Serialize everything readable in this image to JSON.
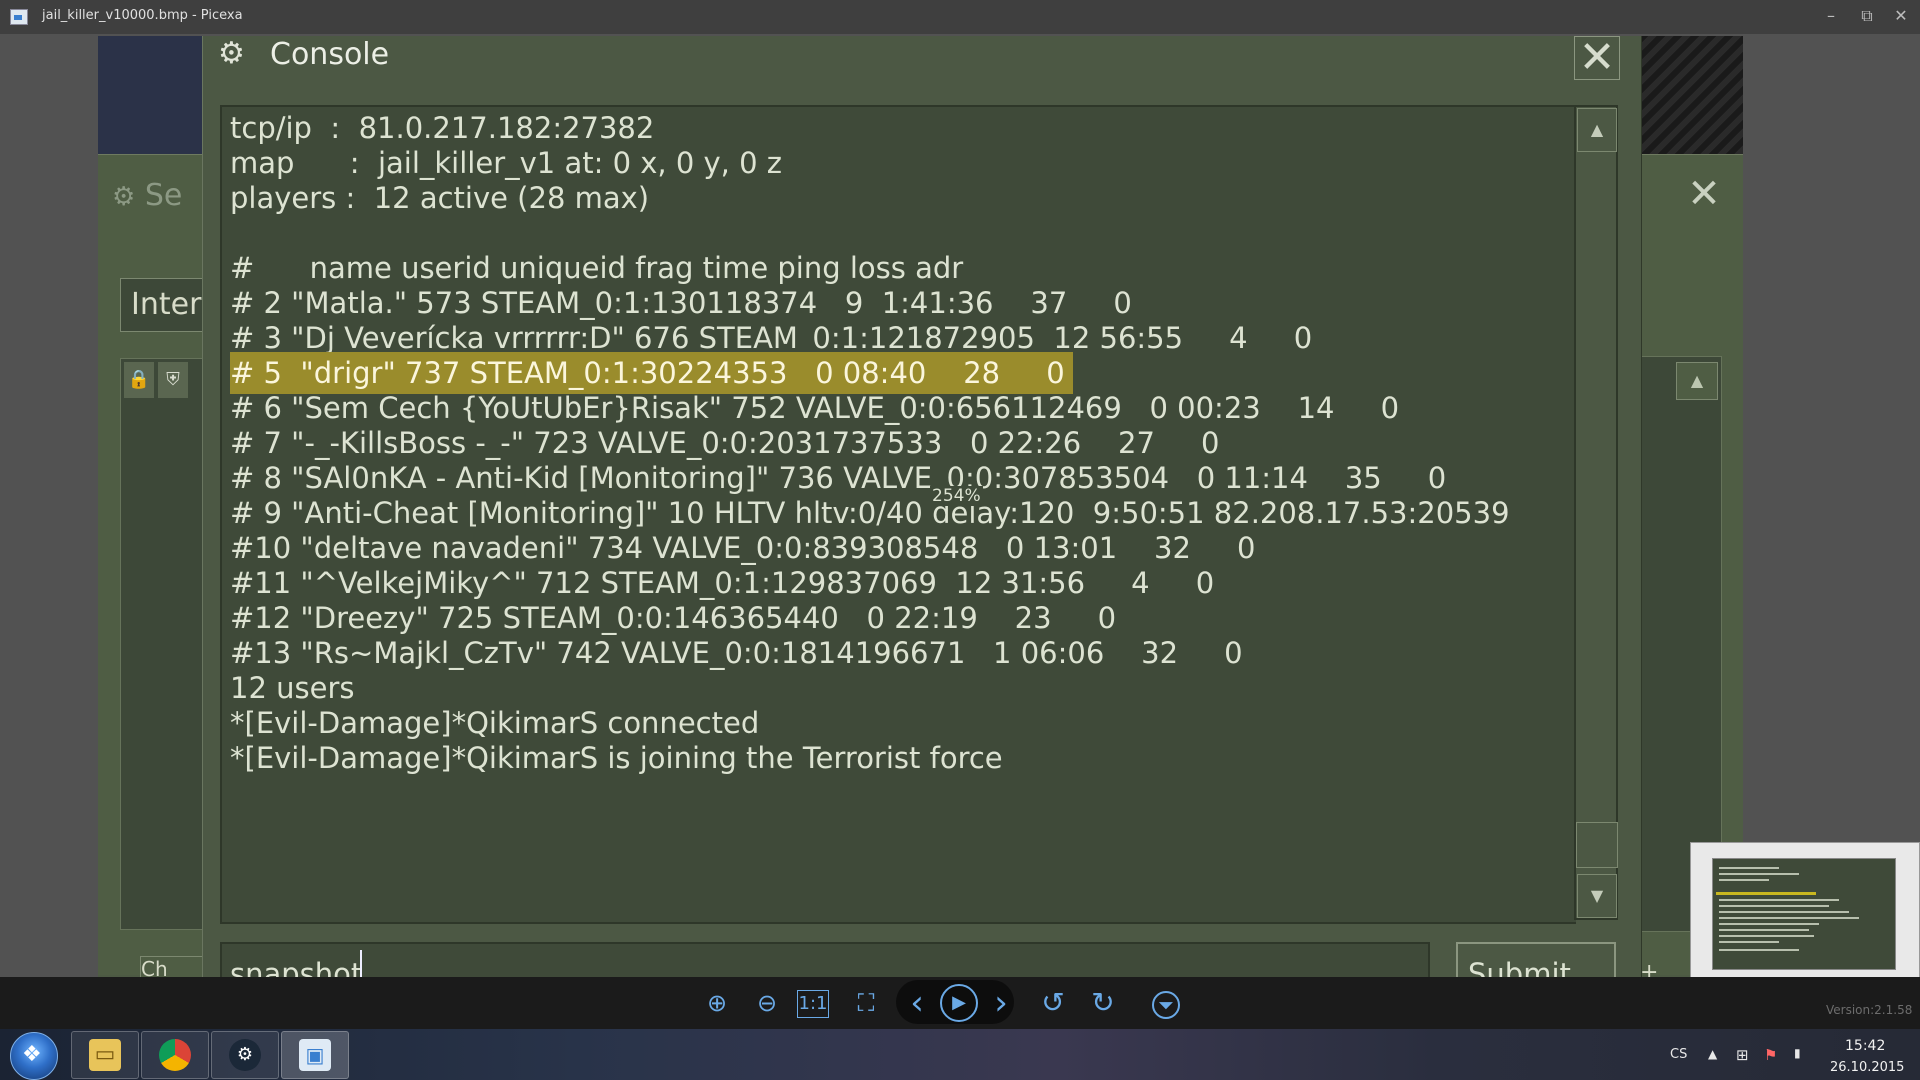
{
  "window": {
    "title": "jail_killer_v10000.bmp - Picexa",
    "minimize": "–",
    "restore": "⧉",
    "close": "✕"
  },
  "server_window": {
    "title": "Se",
    "close": "✕",
    "tab": "Inter",
    "bottom_button": "Ch",
    "plus": "+"
  },
  "console": {
    "title": "Console",
    "close": "✕",
    "lines": [
      "tcp/ip  :  81.0.217.182:27382",
      "map      :  jail_killer_v1 at: 0 x, 0 y, 0 z",
      "players :  12 active (28 max)",
      "",
      "#      name userid uniqueid frag time ping loss adr",
      "# 2 \"Matla.\" 573 STEAM_0:1:130118374   9  1:41:36    37     0",
      "# 3 \"Dj Veverícka vrrrrrr:D\" 676 STEAM_0:1:121872905  12 56:55     4     0",
      "# 5  \"drigr\" 737 STEAM_0:1:30224353   0 08:40    28     0",
      "# 6 \"Sem Cech {YoUtUbEr}Risak\" 752 VALVE_0:0:656112469   0 00:23    14     0",
      "# 7 \"-_-KillsBoss -_-\" 723 VALVE_0:0:2031737533   0 22:26    27     0",
      "# 8 \"SAl0nKA - Anti-Kid [Monitoring]\" 736 VALVE_0:0:307853504   0 11:14    35     0",
      "# 9 \"Anti-Cheat [Monitoring]\" 10 HLTV hltv:0/40 delay:120  9:50:51 82.208.17.53:20539",
      "#10 \"deltave navadeni\" 734 VALVE_0:0:839308548   0 13:01    32     0",
      "#11 \"^VelkejMiky^\" 712 STEAM_0:1:129837069  12 31:56     4     0",
      "#12 \"Dreezy\" 725 STEAM_0:0:146365440   0 22:19    23     0",
      "#13 \"Rs~Majkl_CzTv\" 742 VALVE_0:0:1814196671   1 06:06    32     0",
      "12 users",
      "*[Evil-Damage]*QikimarS connected",
      "*[Evil-Damage]*QikimarS is joining the Terrorist force"
    ],
    "highlighted_line": 7,
    "zoom_tooltip": "254%",
    "input_value": "snapshot",
    "submit_label": "Submit",
    "scroll_up": "▲",
    "scroll_down": "▼"
  },
  "toolbar": {
    "zoom_in": "⊕",
    "zoom_out": "⊖",
    "actual_size": "1:1",
    "fit": "⛶",
    "prev": "‹",
    "play": "▶",
    "next": "›",
    "rotate_left": "↺",
    "rotate_right": "↻",
    "more": "⏷",
    "version": "Version:2.1.58"
  },
  "taskbar": {
    "start": "❖",
    "apps": [
      "file-explorer",
      "chrome",
      "steam",
      "picexa"
    ],
    "tray_lang": "CS",
    "tray_up": "▲",
    "time": "15:42",
    "date": "26.10.2015"
  },
  "colors": {
    "console_bg": "#3f4a39",
    "window_bg": "#4c5844",
    "highlight": "#9a8c2c",
    "accent": "#6aa9e6"
  }
}
